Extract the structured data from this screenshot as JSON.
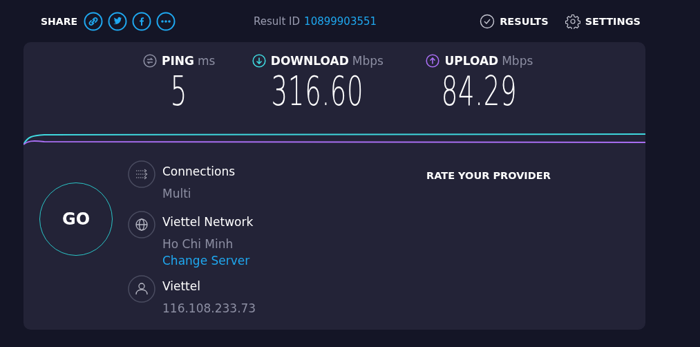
{
  "header": {
    "share_label": "SHARE",
    "share_buttons": [
      {
        "kind": "link"
      },
      {
        "kind": "twitter"
      },
      {
        "kind": "facebook"
      },
      {
        "kind": "more"
      }
    ],
    "result_id_label": "Result ID",
    "result_id": "10899903551",
    "nav": [
      {
        "kind": "results",
        "label": "RESULTS"
      },
      {
        "kind": "settings",
        "label": "SETTINGS"
      }
    ]
  },
  "metrics": [
    {
      "kind": "ping",
      "name": "PING",
      "unit": "ms",
      "value": "5",
      "color": "#8d8fa3"
    },
    {
      "kind": "download",
      "name": "DOWNLOAD",
      "unit": "Mbps",
      "value": "316.60",
      "color": "#3fd7dd"
    },
    {
      "kind": "upload",
      "name": "UPLOAD",
      "unit": "Mbps",
      "value": "84.29",
      "color": "#a86ef2"
    }
  ],
  "go_button": "GO",
  "info": [
    {
      "kind": "connections",
      "title": "Connections",
      "subtitle": "Multi"
    },
    {
      "kind": "server",
      "title": "Viettel Network",
      "subtitle": "Ho Chi Minh",
      "link": "Change Server"
    },
    {
      "kind": "provider",
      "title": "Viettel",
      "subtitle": "116.108.233.73"
    }
  ],
  "rate_label": "RATE YOUR PROVIDER"
}
